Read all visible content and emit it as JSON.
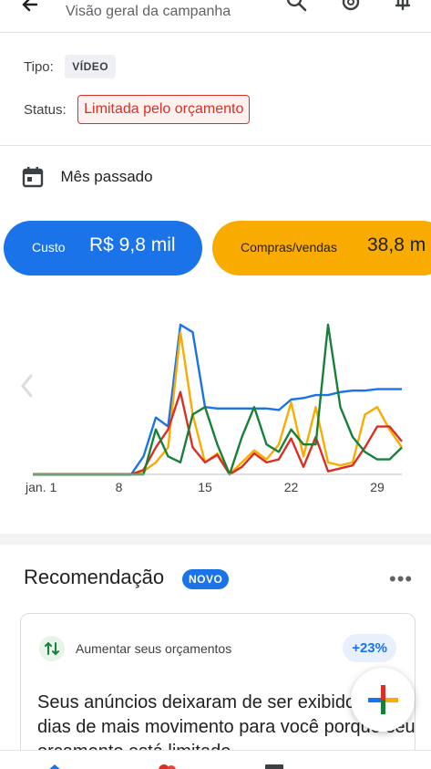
{
  "header": {
    "title": "Visão geral da campanha"
  },
  "meta": {
    "type_label": "Tipo:",
    "type_value": "VÍDEO",
    "status_label": "Status:",
    "status_value": "Limitada pelo orçamento"
  },
  "period": {
    "label": "Mês passado"
  },
  "metrics": {
    "cost_label": "Custo",
    "cost_value": "R$ 9,8 mil",
    "conv_label": "Compras/vendas",
    "conv_value": "38,8 m"
  },
  "chart_data": {
    "type": "line",
    "x_tick_labels": [
      "jan. 1",
      "8",
      "15",
      "22",
      "29"
    ],
    "x": [
      1,
      2,
      3,
      4,
      5,
      6,
      7,
      8,
      9,
      10,
      11,
      12,
      13,
      14,
      15,
      16,
      17,
      18,
      19,
      20,
      21,
      22,
      23,
      24,
      25,
      26,
      27,
      28,
      29,
      30,
      31
    ],
    "series": [
      {
        "color": "#1a73e8",
        "values": [
          0,
          0,
          0,
          0,
          0,
          0,
          0,
          0,
          0,
          12,
          38,
          32,
          100,
          95,
          45,
          44,
          44,
          44,
          44,
          44,
          43,
          50,
          51,
          53,
          53,
          55,
          56,
          56,
          57,
          57,
          57
        ]
      },
      {
        "color": "#f9ab00",
        "values": [
          0,
          0,
          0,
          0,
          0,
          0,
          0,
          0,
          0,
          2,
          8,
          18,
          95,
          40,
          8,
          14,
          0,
          8,
          16,
          10,
          20,
          48,
          12,
          45,
          8,
          6,
          8,
          40,
          45,
          30,
          18
        ]
      },
      {
        "color": "#d93025",
        "values": [
          0,
          0,
          0,
          0,
          0,
          0,
          0,
          0,
          0,
          3,
          18,
          30,
          55,
          18,
          8,
          13,
          0,
          5,
          14,
          8,
          10,
          24,
          5,
          25,
          2,
          4,
          6,
          18,
          32,
          32,
          22
        ]
      },
      {
        "color": "#188038",
        "values": [
          0,
          0,
          0,
          0,
          0,
          0,
          0,
          0,
          0,
          0,
          30,
          12,
          8,
          40,
          45,
          20,
          0,
          25,
          45,
          20,
          15,
          30,
          20,
          20,
          100,
          45,
          25,
          15,
          10,
          10,
          18
        ]
      }
    ]
  },
  "recommendations": {
    "title": "Recomendação",
    "badge": "NOVO",
    "more": "•••",
    "card": {
      "tip_label": "Aumentar seus orçamentos",
      "pct": "+23%",
      "description": "Seus anúncios deixaram de ser exibidos nos dias de mais movimento para você porque seu orçamento está limitado."
    }
  },
  "colors": {
    "accent": "#1a73e8",
    "warning": "#d93025",
    "amber": "#f9ab00",
    "green": "#188038"
  }
}
